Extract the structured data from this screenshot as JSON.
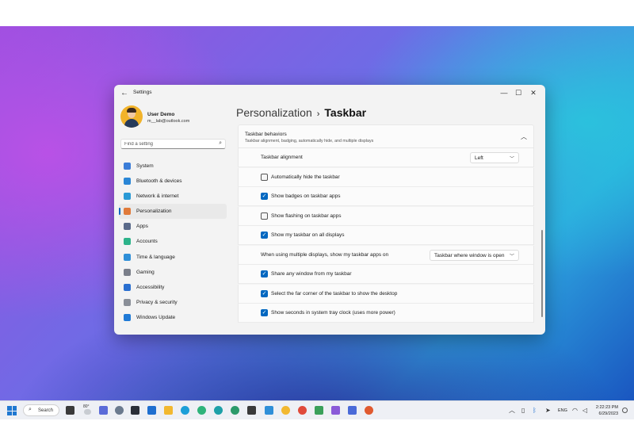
{
  "window": {
    "app_title": "Settings",
    "minimize": "—",
    "maximize": "☐",
    "close": "✕"
  },
  "profile": {
    "name": "User Demo",
    "email": "m__lab@outlook.com"
  },
  "search": {
    "placeholder": "Find a setting"
  },
  "sidebar": {
    "items": [
      {
        "label": "System",
        "icon": "monitor-icon",
        "color": "#3b7dd8"
      },
      {
        "label": "Bluetooth & devices",
        "icon": "bluetooth-icon",
        "color": "#2a86d6"
      },
      {
        "label": "Network & internet",
        "icon": "wifi-icon",
        "color": "#2a9ad6"
      },
      {
        "label": "Personalization",
        "icon": "brush-icon",
        "color": "#e07a3a",
        "active": true
      },
      {
        "label": "Apps",
        "icon": "apps-icon",
        "color": "#5a6a8a"
      },
      {
        "label": "Accounts",
        "icon": "person-icon",
        "color": "#2db38a"
      },
      {
        "label": "Time & language",
        "icon": "globe-clock-icon",
        "color": "#2f8fd8"
      },
      {
        "label": "Gaming",
        "icon": "gamepad-icon",
        "color": "#7a7f8a"
      },
      {
        "label": "Accessibility",
        "icon": "accessibility-icon",
        "color": "#2a6fd0"
      },
      {
        "label": "Privacy & security",
        "icon": "shield-icon",
        "color": "#8a8f98"
      },
      {
        "label": "Windows Update",
        "icon": "update-icon",
        "color": "#1f7ad6"
      }
    ]
  },
  "breadcrumb": {
    "parent": "Personalization",
    "separator": "›",
    "current": "Taskbar"
  },
  "section": {
    "title": "Taskbar behaviors",
    "description": "Taskbar alignment, badging, automatically hide, and multiple displays"
  },
  "rows": {
    "alignment": {
      "label": "Taskbar alignment",
      "value": "Left"
    },
    "auto_hide": {
      "label": "Automatically hide the taskbar",
      "checked": false
    },
    "badges": {
      "label": "Show badges on taskbar apps",
      "checked": true
    },
    "flashing": {
      "label": "Show flashing on taskbar apps",
      "checked": false
    },
    "all_displays": {
      "label": "Show my taskbar on all displays",
      "checked": true
    },
    "multi_display": {
      "label": "When using multiple displays, show my taskbar apps on",
      "value": "Taskbar where window is open"
    },
    "share_window": {
      "label": "Share any window from my taskbar",
      "checked": true
    },
    "far_corner": {
      "label": "Select the far corner of the taskbar to show the desktop",
      "checked": true
    },
    "seconds_clock": {
      "label": "Show seconds in system tray clock (uses more power)",
      "checked": true
    }
  },
  "taskbar": {
    "search_label": "Search",
    "weather": "80°",
    "language": "ENG",
    "time": "2:22:23 PM",
    "date": "6/29/2023",
    "check_mark": "✓"
  }
}
